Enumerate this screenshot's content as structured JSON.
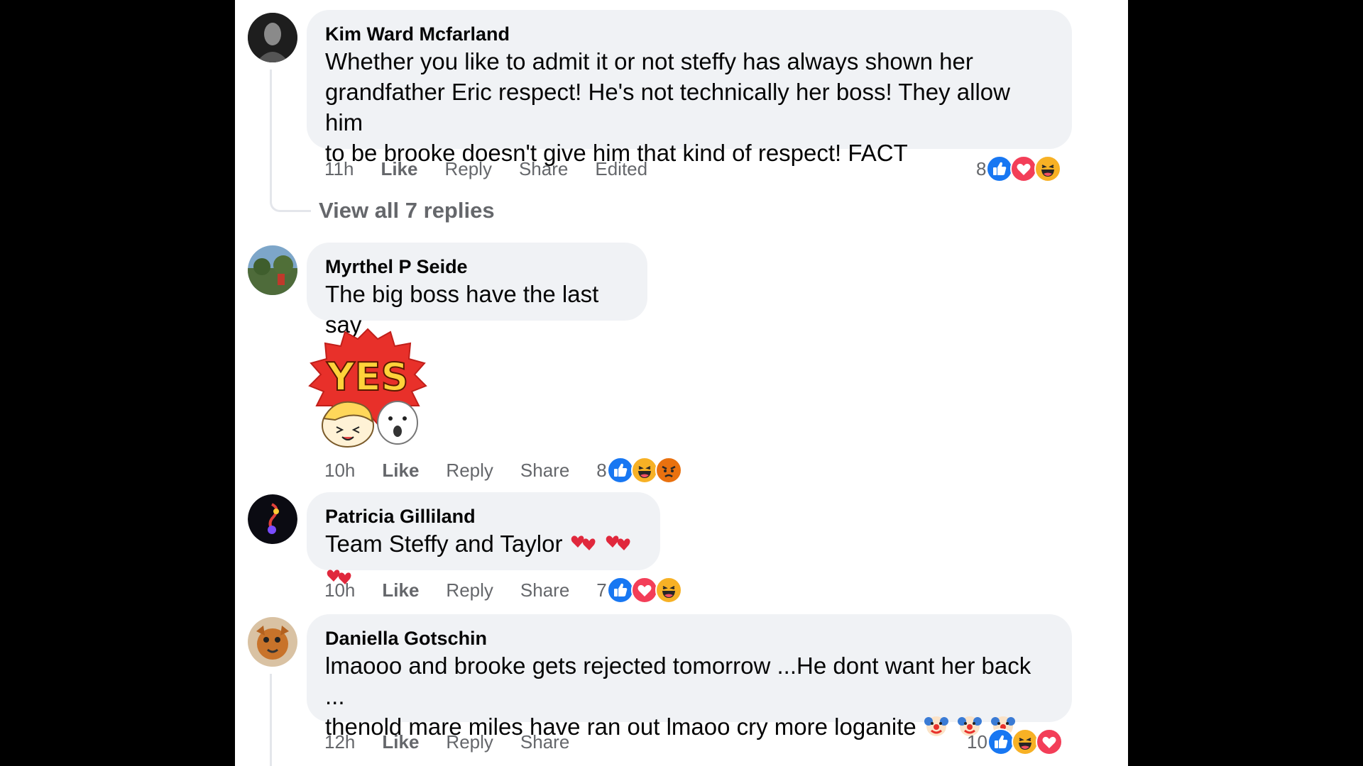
{
  "comments": [
    {
      "author": "Kim Ward Mcfarland",
      "lines": [
        "Whether you like to admit it or not steffy has always shown her",
        "grandfather Eric respect! He's not technically her boss! They allow him",
        "to be brooke doesn't give him that kind of respect! FACT"
      ],
      "time": "11h",
      "like": "Like",
      "reply": "Reply",
      "share": "Share",
      "edited": "Edited",
      "reaction_count": "8",
      "reactions": [
        "like-reaction-icon",
        "love-reaction-icon",
        "haha-reaction-icon"
      ],
      "view_replies": "View all 7 replies"
    },
    {
      "author": "Myrthel P Seide",
      "text": "The big boss have the last say",
      "sticker_text": "YES",
      "time": "10h",
      "like": "Like",
      "reply": "Reply",
      "share": "Share",
      "reaction_count": "8",
      "reactions": [
        "like-reaction-icon",
        "haha-reaction-icon",
        "angry-reaction-icon"
      ]
    },
    {
      "author": "Patricia Gilliland",
      "text": "Team Steffy and Taylor",
      "emojis": [
        "heart-emoji",
        "heart-emoji",
        "heart-emoji"
      ],
      "time": "10h",
      "like": "Like",
      "reply": "Reply",
      "share": "Share",
      "reaction_count": "7",
      "reactions": [
        "like-reaction-icon",
        "love-reaction-icon",
        "haha-reaction-icon"
      ]
    },
    {
      "author": "Daniella Gotschin",
      "lines": [
        "lmaooo and brooke gets rejected tomorrow ...He dont want her back ...",
        "thenold mare miles have ran out lmaoo cry more loganite"
      ],
      "emojis": [
        "clown-emoji",
        "clown-emoji",
        "clown-emoji"
      ],
      "time": "12h",
      "like": "Like",
      "reply": "Reply",
      "share": "Share",
      "reaction_count": "10",
      "reactions": [
        "like-reaction-icon",
        "haha-reaction-icon",
        "love-reaction-icon"
      ]
    }
  ],
  "colors": {
    "bubble": "#f0f2f5",
    "meta_text": "#65676b",
    "like_blue": "#1877f2",
    "love_red": "#f33e58",
    "haha_yellow": "#f7b125",
    "angry_orange": "#e9710f"
  }
}
